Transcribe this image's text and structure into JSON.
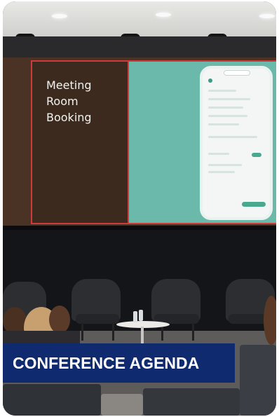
{
  "photo": {
    "subject": "conference-room-presentation",
    "slide": {
      "title": "Meeting\nRoom\nBooking"
    },
    "colors": {
      "slide_dark": "#3c2a1f",
      "slide_teal": "#6bb9ab",
      "slide_border": "#cf3a3a"
    }
  },
  "banner": {
    "label": "CONFERENCE AGENDA",
    "color": "#0f2a6e"
  }
}
